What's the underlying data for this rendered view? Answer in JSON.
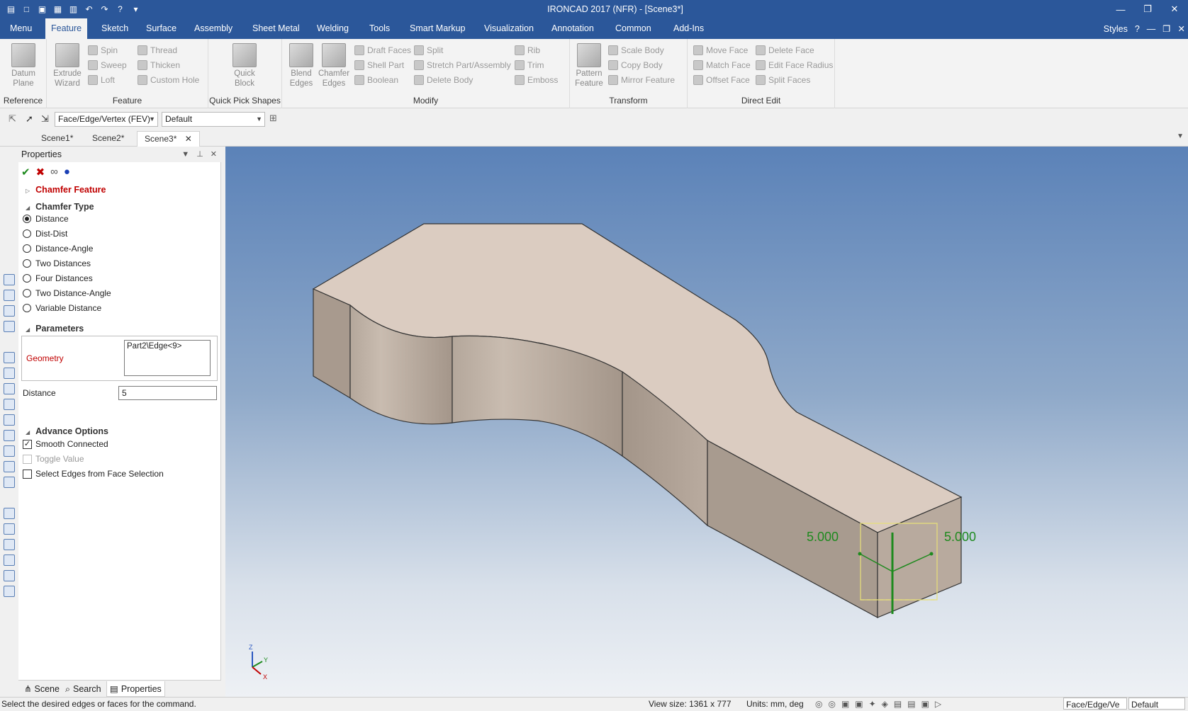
{
  "window": {
    "title": "IRONCAD 2017 (NFR) - [Scene3*]"
  },
  "menu_tabs": [
    "Menu",
    "Feature",
    "Sketch",
    "Surface",
    "Assembly",
    "Sheet Metal",
    "Welding",
    "Tools",
    "Smart Markup",
    "Visualization",
    "Annotation",
    "Common",
    "Add-Ins"
  ],
  "active_tab": "Feature",
  "styles_label": "Styles",
  "ribbon": {
    "reference": {
      "label": "Reference",
      "datum_plane": "Datum Plane"
    },
    "feature": {
      "label": "Feature",
      "extrude_wizard": "Extrude Wizard",
      "spin": "Spin",
      "sweep": "Sweep",
      "loft": "Loft",
      "thread": "Thread",
      "thicken": "Thicken",
      "custom_hole": "Custom Hole"
    },
    "quick_pick": {
      "label": "Quick Pick Shapes",
      "quick_block": "Quick Block"
    },
    "modify": {
      "label": "Modify",
      "blend_edges": "Blend Edges",
      "chamfer_edges": "Chamfer Edges",
      "draft_faces": "Draft Faces",
      "shell_part": "Shell Part",
      "boolean": "Boolean",
      "split": "Split",
      "stretch": "Stretch Part/Assembly",
      "delete_body": "Delete Body",
      "rib": "Rib",
      "trim": "Trim",
      "emboss": "Emboss"
    },
    "transform": {
      "label": "Transform",
      "pattern_feature": "Pattern Feature",
      "scale_body": "Scale Body",
      "copy_body": "Copy Body",
      "mirror_feature": "Mirror Feature"
    },
    "direct_edit": {
      "label": "Direct Edit",
      "move_face": "Move Face",
      "match_face": "Match Face",
      "offset_face": "Offset Face",
      "delete_face": "Delete Face",
      "edit_face_radius": "Edit Face Radius",
      "split_faces": "Split Faces"
    }
  },
  "selection_bar": {
    "filter": "Face/Edge/Vertex (FEV)",
    "style": "Default"
  },
  "scene_tabs": [
    "Scene1*",
    "Scene2*",
    "Scene3*"
  ],
  "properties": {
    "title": "Properties",
    "feature_header": "Chamfer Feature",
    "chamfer_type_header": "Chamfer Type",
    "chamfer_types": [
      "Distance",
      "Dist-Dist",
      "Distance-Angle",
      "Two Distances",
      "Four Distances",
      "Two Distance-Angle",
      "Variable Distance"
    ],
    "selected_type_index": 0,
    "parameters_header": "Parameters",
    "geometry_label": "Geometry",
    "geometry_value": "Part2\\Edge<9>",
    "distance_label": "Distance",
    "distance_value": "5",
    "advance_header": "Advance Options",
    "smooth_connected": "Smooth Connected",
    "toggle_value": "Toggle Value",
    "select_edges": "Select Edges from Face Selection"
  },
  "bottom_tabs": [
    "Scene",
    "Search",
    "Properties"
  ],
  "viewport": {
    "dim_left": "5.000",
    "dim_right": "5.000",
    "axis_z": "Z",
    "axis_y": "Y",
    "axis_x": "X"
  },
  "status": {
    "message": "Select the desired edges or faces for the command.",
    "view_size": "View size: 1361 x 777",
    "units": "Units: mm, deg",
    "filter": "Face/Edge/Ve",
    "style": "Default"
  },
  "colors": {
    "title_blue": "#2b579a",
    "accent_red": "#c00000",
    "dim_green": "#1e8a1e"
  }
}
